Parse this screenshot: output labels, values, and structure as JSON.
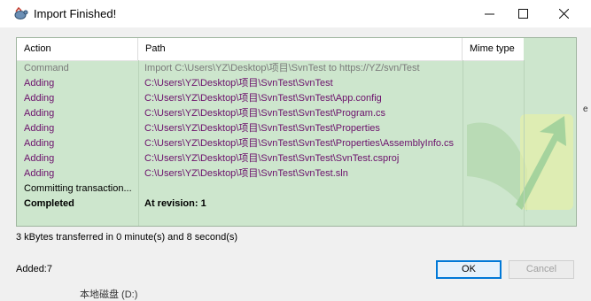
{
  "window": {
    "title": "Import Finished!",
    "icon": "tortoise-icon"
  },
  "columns": {
    "action": "Action",
    "path": "Path",
    "mime": "Mime type"
  },
  "rows": [
    {
      "action": "Command",
      "path": "Import C:\\Users\\YZ\\Desktop\\项目\\SvnTest to https://YZ/svn/Test",
      "style": "gray"
    },
    {
      "action": "Adding",
      "path": "C:\\Users\\YZ\\Desktop\\项目\\SvnTest\\SvnTest",
      "style": "purple"
    },
    {
      "action": "Adding",
      "path": "C:\\Users\\YZ\\Desktop\\项目\\SvnTest\\SvnTest\\App.config",
      "style": "purple"
    },
    {
      "action": "Adding",
      "path": "C:\\Users\\YZ\\Desktop\\项目\\SvnTest\\SvnTest\\Program.cs",
      "style": "purple"
    },
    {
      "action": "Adding",
      "path": "C:\\Users\\YZ\\Desktop\\项目\\SvnTest\\SvnTest\\Properties",
      "style": "purple"
    },
    {
      "action": "Adding",
      "path": "C:\\Users\\YZ\\Desktop\\项目\\SvnTest\\SvnTest\\Properties\\AssemblyInfo.cs",
      "style": "purple"
    },
    {
      "action": "Adding",
      "path": "C:\\Users\\YZ\\Desktop\\项目\\SvnTest\\SvnTest\\SvnTest.csproj",
      "style": "purple"
    },
    {
      "action": "Adding",
      "path": "C:\\Users\\YZ\\Desktop\\项目\\SvnTest\\SvnTest.sln",
      "style": "purple"
    },
    {
      "action": "Committing transaction...",
      "path": "",
      "style": "black"
    },
    {
      "action": "Completed",
      "path": "At revision: 1",
      "style": "bold"
    }
  ],
  "status": {
    "transfer": "3 kBytes transferred in 0 minute(s) and 8 second(s)",
    "added": "Added:7"
  },
  "buttons": {
    "ok": "OK",
    "cancel": "Cancel"
  },
  "background": {
    "tail_text": "本地磁盘 (D:)",
    "right_text": "e"
  },
  "colors": {
    "list_bg": "#cde6cd",
    "path_text": "#6b0f6b",
    "command_text": "#7a7a7a"
  }
}
